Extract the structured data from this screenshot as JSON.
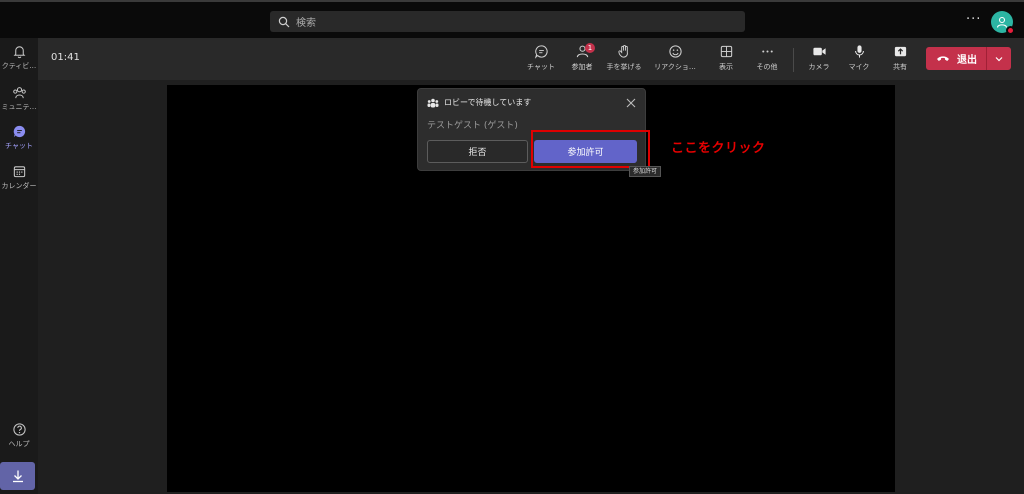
{
  "topbar": {
    "search_placeholder": "検索",
    "more_label": "···",
    "avatar_status_color": "#e81e3c"
  },
  "rail": {
    "items": [
      {
        "label": "クティビ…",
        "icon": "bell-icon"
      },
      {
        "label": "ミュニテ…",
        "icon": "people-icon"
      },
      {
        "label": "チャット",
        "icon": "chat-icon",
        "active": true
      },
      {
        "label": "カレンダー",
        "icon": "calendar-icon"
      }
    ],
    "help_label": "ヘルプ",
    "download_icon": "download-icon"
  },
  "meeting": {
    "timer": "01:41",
    "controls": [
      {
        "label": "チャット",
        "icon": "chat-icon"
      },
      {
        "label": "参加者",
        "icon": "participants-icon",
        "badge": "1"
      },
      {
        "label": "手を挙げる",
        "icon": "hand-icon"
      },
      {
        "label": "リアクショ…",
        "icon": "smile-icon"
      },
      {
        "label": "表示",
        "icon": "layout-icon"
      },
      {
        "label": "その他",
        "icon": "more-icon"
      },
      {
        "label": "カメラ",
        "icon": "camera-icon"
      },
      {
        "label": "マイク",
        "icon": "mic-icon"
      },
      {
        "label": "共有",
        "icon": "share-icon"
      }
    ],
    "leave_label": "退出",
    "leave_color": "#c4314b"
  },
  "lobby": {
    "title": "ロビーで待機しています",
    "guest_name": "テストゲスト (ゲスト)",
    "deny_label": "拒否",
    "admit_label": "参加許可",
    "admit_color": "#6264c9"
  },
  "tooltip": "参加許可",
  "annotation": {
    "text": "ここをクリック",
    "color": "#e60000"
  }
}
